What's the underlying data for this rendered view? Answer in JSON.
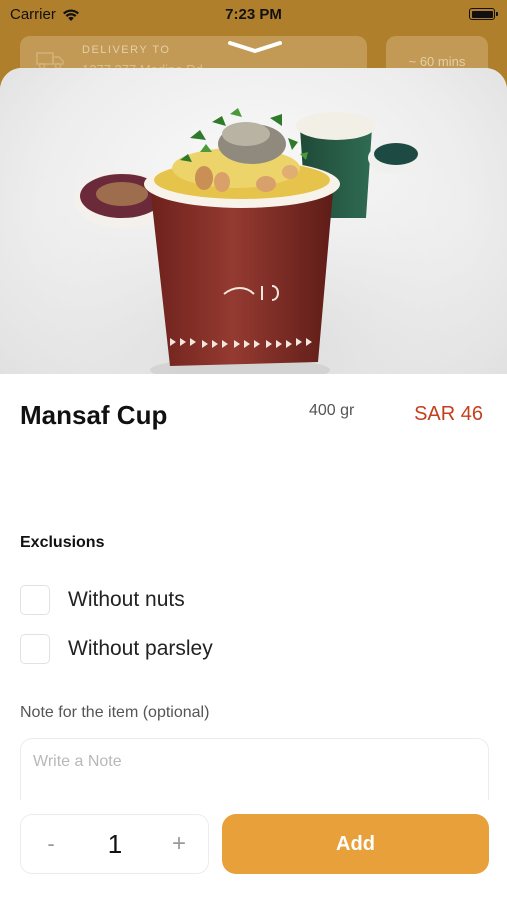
{
  "status_bar": {
    "carrier": "Carrier",
    "time": "7:23 PM"
  },
  "background": {
    "delivery_label": "DELIVERY TO",
    "delivery_address": "1277 277 Madina Rd",
    "time_estimate": "~ 60 mins"
  },
  "product": {
    "name": "Mansaf Cup",
    "weight": "400 gr",
    "price": "SAR 46"
  },
  "exclusions": {
    "title": "Exclusions",
    "options": [
      {
        "label": "Without nuts",
        "checked": false
      },
      {
        "label": "Without parsley",
        "checked": false
      }
    ]
  },
  "note": {
    "label": "Note for the item (optional)",
    "placeholder": "Write a Note",
    "value": ""
  },
  "order": {
    "minus": "-",
    "quantity": "1",
    "plus": "+",
    "add_label": "Add"
  },
  "colors": {
    "accent": "#e8a03b",
    "price": "#c3401f",
    "backdrop": "#b07f2c"
  }
}
